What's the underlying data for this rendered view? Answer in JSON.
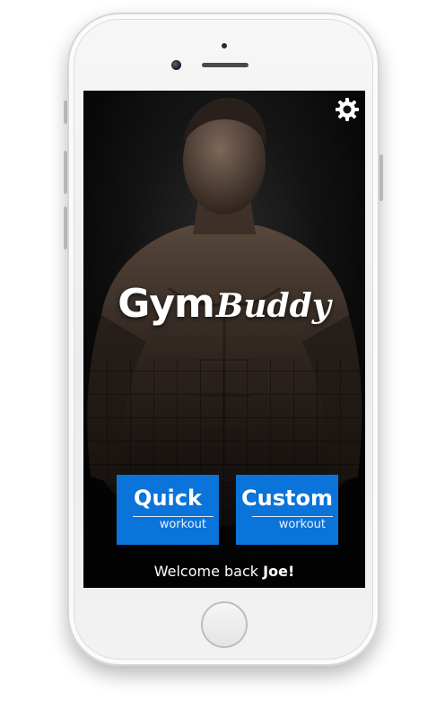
{
  "app": {
    "logo_part1": "Gym",
    "logo_part2": "Buddy",
    "settings_icon": "gear-icon"
  },
  "actions": {
    "quick": {
      "title": "Quick",
      "subtitle": "workout"
    },
    "custom": {
      "title": "Custom",
      "subtitle": "workout"
    }
  },
  "welcome": {
    "prefix": "Welcome back ",
    "name": "Joe!"
  },
  "colors": {
    "accent": "#0A74DA",
    "screen_background": "#0C0C0C",
    "text": "#FFFFFF"
  }
}
